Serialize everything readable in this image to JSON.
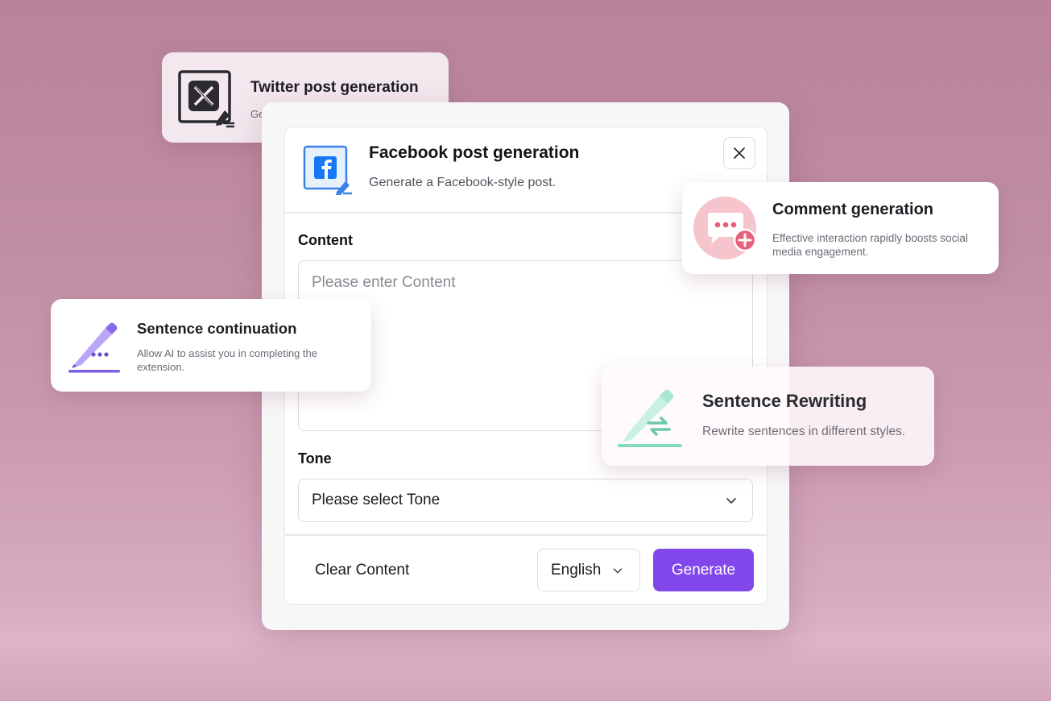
{
  "twitter_card": {
    "title": "Twitter post generation",
    "desc": "Ge"
  },
  "main": {
    "title": "Facebook post generation",
    "desc": "Generate a Facebook-style post.",
    "content_label": "Content",
    "content_placeholder": "Please enter Content",
    "tone_label": "Tone",
    "tone_value": "Please select Tone",
    "clear_label": "Clear Content",
    "language_value": "English",
    "generate_label": "Generate"
  },
  "comment_card": {
    "title": "Comment generation",
    "desc": "Effective interaction rapidly boosts social media engagement."
  },
  "continuation_card": {
    "title": "Sentence continuation",
    "desc": "Allow AI to assist you in completing the extension."
  },
  "rewriting_card": {
    "title": "Sentence Rewriting",
    "desc": "Rewrite sentences in different styles."
  },
  "colors": {
    "accent": "#8147ea",
    "facebook": "#1877f2",
    "comment_pink": "#ee6f86",
    "continuation_purple": "#9b7cf0",
    "rewriting_mint": "#84d8bd"
  },
  "icons": {
    "twitter": "x-logo-edit-icon",
    "facebook": "facebook-logo-edit-icon",
    "close": "close-icon",
    "comment": "chat-bubble-plus-icon",
    "continuation": "pencil-dots-icon",
    "rewriting": "pencil-swap-icon",
    "chevron": "chevron-down-icon"
  }
}
